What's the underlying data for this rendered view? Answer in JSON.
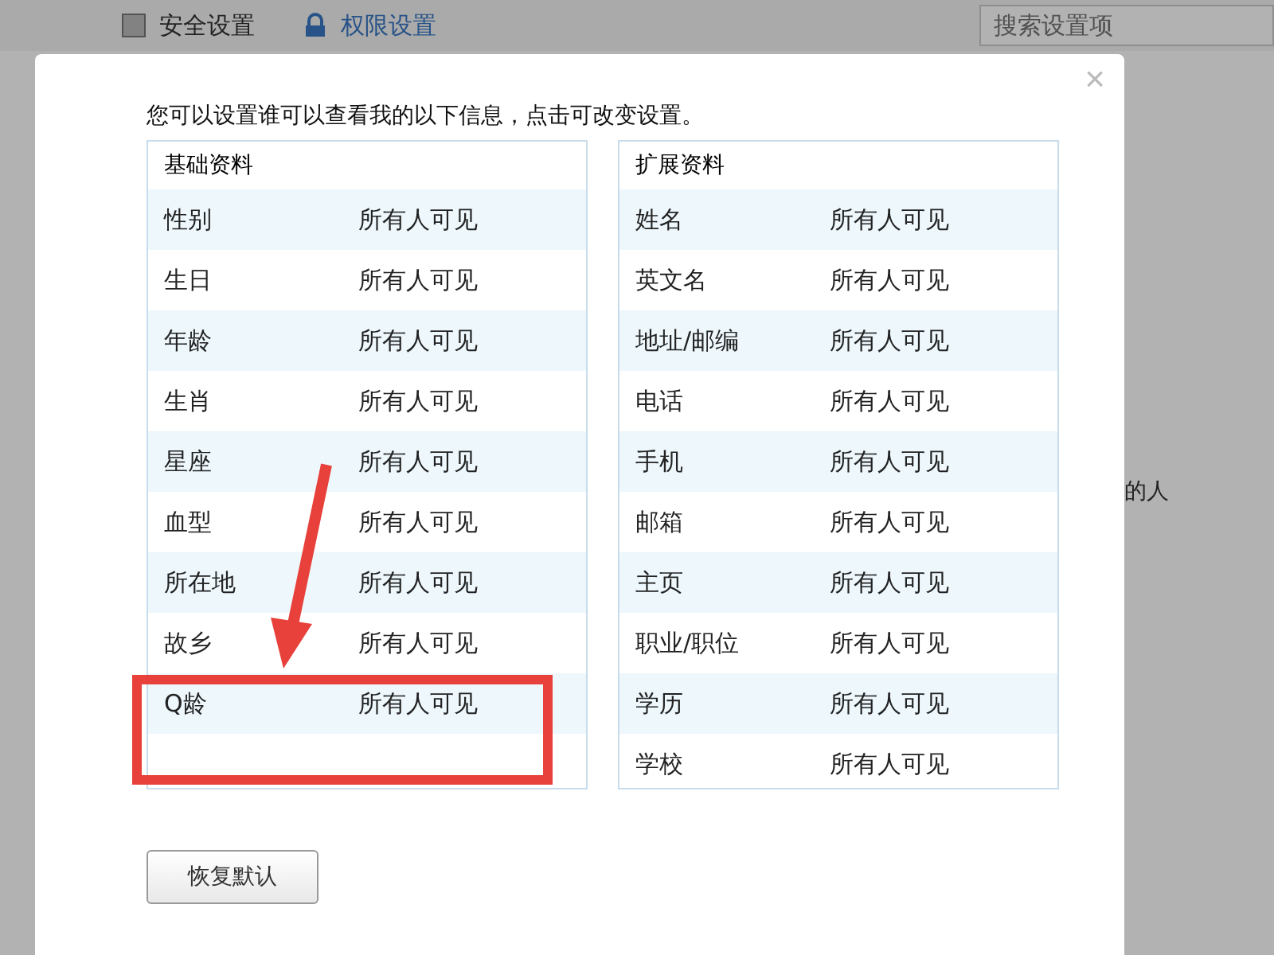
{
  "background": {
    "tabs": [
      {
        "label": "安全设置",
        "selected": false
      },
      {
        "label": "权限设置",
        "selected": true
      }
    ],
    "search": {
      "placeholder": "搜索设置项"
    },
    "side_text": "的人"
  },
  "dialog": {
    "close": "×",
    "instruction": "您可以设置谁可以查看我的以下信息，点击可改变设置。",
    "panels": [
      {
        "title": "基础资料",
        "rows": [
          {
            "label": "性别",
            "value": "所有人可见"
          },
          {
            "label": "生日",
            "value": "所有人可见"
          },
          {
            "label": "年龄",
            "value": "所有人可见"
          },
          {
            "label": "生肖",
            "value": "所有人可见"
          },
          {
            "label": "星座",
            "value": "所有人可见"
          },
          {
            "label": "血型",
            "value": "所有人可见"
          },
          {
            "label": "所在地",
            "value": "所有人可见"
          },
          {
            "label": "故乡",
            "value": "所有人可见"
          },
          {
            "label": "Q龄",
            "value": "所有人可见"
          }
        ]
      },
      {
        "title": "扩展资料",
        "rows": [
          {
            "label": "姓名",
            "value": "所有人可见"
          },
          {
            "label": "英文名",
            "value": "所有人可见"
          },
          {
            "label": "地址/邮编",
            "value": "所有人可见"
          },
          {
            "label": "电话",
            "value": "所有人可见"
          },
          {
            "label": "手机",
            "value": "所有人可见"
          },
          {
            "label": "邮箱",
            "value": "所有人可见"
          },
          {
            "label": "主页",
            "value": "所有人可见"
          },
          {
            "label": "职业/职位",
            "value": "所有人可见"
          },
          {
            "label": "学历",
            "value": "所有人可见"
          },
          {
            "label": "学校",
            "value": "所有人可见"
          }
        ]
      }
    ],
    "button": "恢复默认"
  }
}
